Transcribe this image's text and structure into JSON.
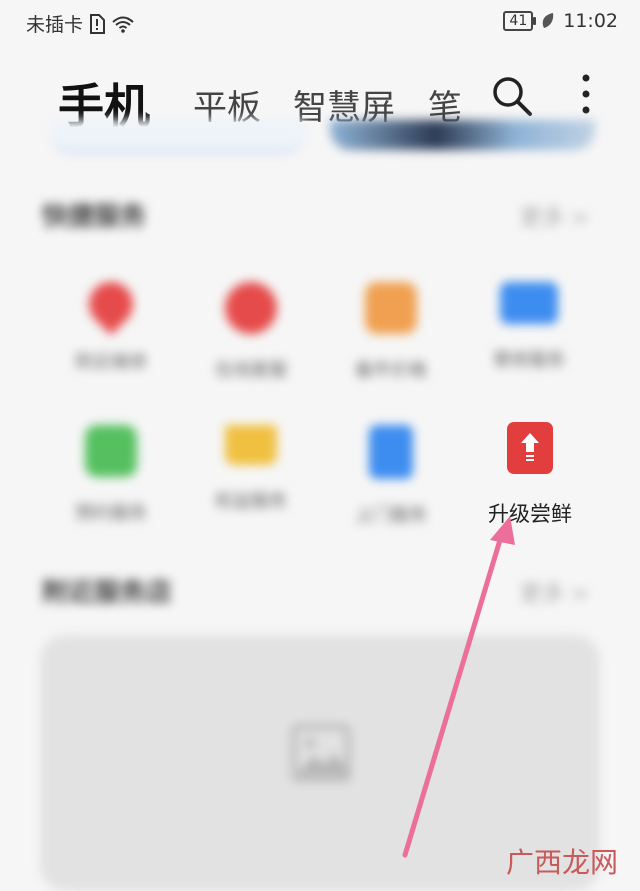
{
  "status": {
    "carrier": "未插卡",
    "battery": "41",
    "time": "11:02"
  },
  "tabs": [
    "手机",
    "平板",
    "智慧屏",
    "笔记本"
  ],
  "icons": {
    "search": "search-icon",
    "more": "more-vertical-icon",
    "arrow": "pink-arrow",
    "upgrade": "upgrade-arrow-icon"
  },
  "sections": {
    "quick_services": {
      "title": "快捷服务",
      "more": "更多 >"
    },
    "nearby": {
      "title": "附近服务店",
      "more": "更多 >"
    }
  },
  "services": [
    {
      "label": "附近维修",
      "color": "#e64b4b",
      "blurred": true
    },
    {
      "label": "在线客服",
      "color": "#e64b4b",
      "blurred": true
    },
    {
      "label": "备件价格",
      "color": "#f0a050",
      "blurred": true
    },
    {
      "label": "寄修服务",
      "color": "#3d8df0",
      "blurred": true
    },
    {
      "label": "预约服务",
      "color": "#55c060",
      "blurred": true
    },
    {
      "label": "权益服务",
      "color": "#f0c040",
      "blurred": true
    },
    {
      "label": "上门服务",
      "color": "#3d8df0",
      "blurred": true
    },
    {
      "label": "升级尝鲜",
      "color": "#e23e3e",
      "blurred": false
    }
  ],
  "watermark": "广西龙网",
  "colors": {
    "accent_arrow": "#ec6e9a",
    "upgrade_red": "#e23e3e"
  }
}
